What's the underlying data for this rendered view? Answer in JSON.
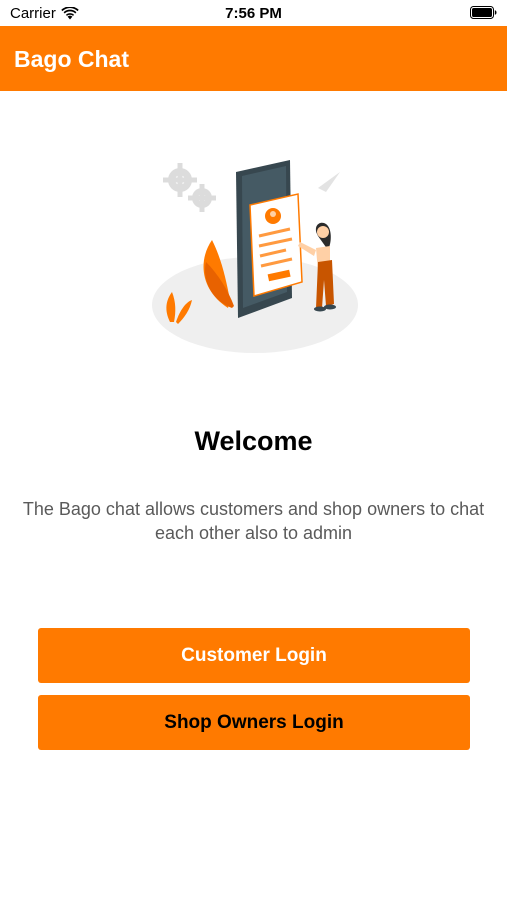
{
  "status_bar": {
    "carrier": "Carrier",
    "time": "7:56 PM",
    "wifi_icon": "wifi-icon",
    "battery_icon": "battery-icon"
  },
  "nav_bar": {
    "title": "Bago Chat",
    "background_color": "#ff7a00"
  },
  "hero": {
    "illustration": "phone-profile-illustration"
  },
  "main": {
    "heading": "Welcome",
    "description": "The Bago chat allows customers and shop owners to chat each other also to admin"
  },
  "actions": {
    "customer_login_label": "Customer Login",
    "shop_owners_login_label": "Shop Owners Login",
    "button_color": "#ff7a00"
  }
}
